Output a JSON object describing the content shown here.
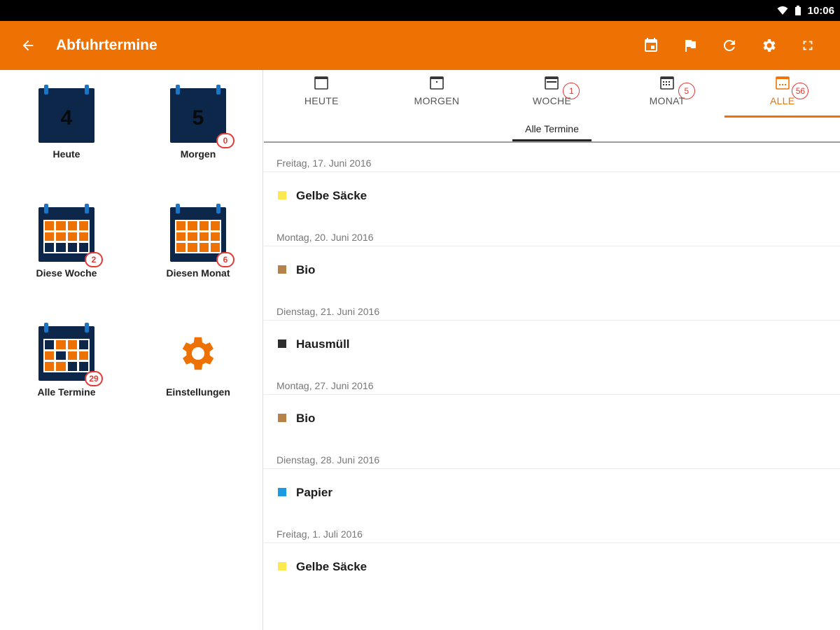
{
  "status": {
    "time": "10:06"
  },
  "appbar": {
    "title": "Abfuhrtermine"
  },
  "tiles": {
    "heute": {
      "label": "Heute",
      "number": "4"
    },
    "morgen": {
      "label": "Morgen",
      "number": "5",
      "badge": "0"
    },
    "woche": {
      "label": "Diese Woche",
      "badge": "2"
    },
    "monat": {
      "label": "Diesen Monat",
      "badge": "6"
    },
    "alle": {
      "label": "Alle Termine",
      "badge": "29"
    },
    "einstellungen": {
      "label": "Einstellungen"
    }
  },
  "tabs": [
    {
      "label": "HEUTE",
      "badge": ""
    },
    {
      "label": "MORGEN",
      "badge": ""
    },
    {
      "label": "WOCHE",
      "badge": "1"
    },
    {
      "label": "MONAT",
      "badge": "5"
    },
    {
      "label": "ALLE",
      "badge": "56"
    }
  ],
  "subtab": {
    "label": "Alle Termine"
  },
  "entries": [
    {
      "date": "Freitag, 17. Juni 2016",
      "name": "Gelbe Säcke",
      "color": "#fce94f"
    },
    {
      "date": "Montag, 20. Juni 2016",
      "name": "Bio",
      "color": "#b5824a"
    },
    {
      "date": "Dienstag, 21. Juni 2016",
      "name": "Hausmüll",
      "color": "#2d2d2d"
    },
    {
      "date": "Montag, 27. Juni 2016",
      "name": "Bio",
      "color": "#b5824a"
    },
    {
      "date": "Dienstag, 28. Juni 2016",
      "name": "Papier",
      "color": "#1e9be0"
    },
    {
      "date": "Freitag, 1. Juli 2016",
      "name": "Gelbe Säcke",
      "color": "#fce94f"
    }
  ],
  "colors": {
    "accent": "#ee7203",
    "navy": "#0c2749",
    "badge": "#e53935"
  }
}
